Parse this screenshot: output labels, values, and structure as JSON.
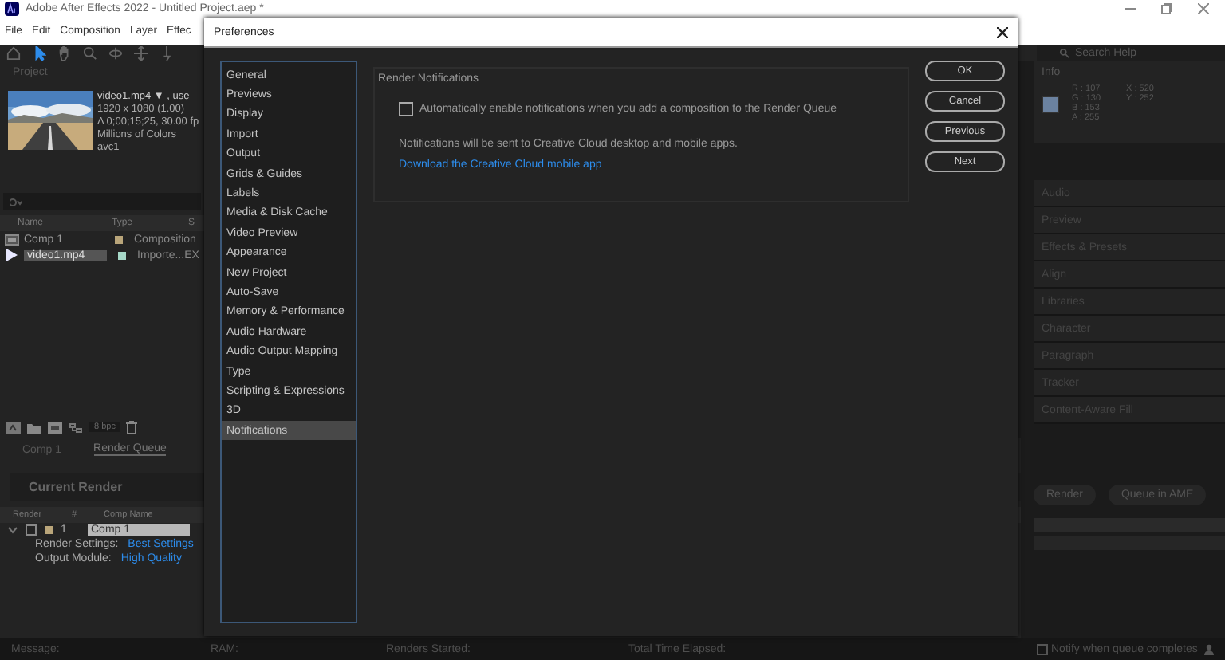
{
  "app_window": {
    "title": "Adobe After Effects 2022 - Untitled Project.aep *"
  },
  "menu_bar": [
    "File",
    "Edit",
    "Composition",
    "Layer",
    "Effec"
  ],
  "project_panel": {
    "title": "Project",
    "footage_info": [
      "video1.mp4 ▼ , use",
      "1920 x 1080 (1.00)",
      "Δ 0;00;15;25, 30.00 fp",
      "Millions of Colors",
      "avc1"
    ],
    "columns": [
      "Name",
      "Type",
      "S"
    ],
    "items": [
      {
        "name": "Comp 1",
        "type": "Composition",
        "kind": "composition",
        "color": "#b9a57a",
        "selected": false
      },
      {
        "name": "video1.mp4",
        "type": "Importe...EX",
        "kind": "footage",
        "color": "#a6d8c8",
        "selected": true
      }
    ],
    "bit_depth": "8 bpc"
  },
  "timeline_tabs": [
    {
      "label": "Comp 1",
      "selected": false
    },
    {
      "label": "Render Queue",
      "selected": true
    }
  ],
  "render_queue": {
    "current_render": "Current Render",
    "columns": [
      "Render",
      "#",
      "Comp Name"
    ],
    "items": [
      {
        "number": "1",
        "comp_name": "Comp 1",
        "checked": false,
        "render_settings_label": "Render Settings:",
        "render_settings": "Best Settings",
        "output_module_label": "Output Module:",
        "output_module": "High Quality"
      }
    ],
    "buttons": [
      "Render",
      "Queue in AME"
    ]
  },
  "right_panel": {
    "search": {
      "placeholder": "Search Help"
    },
    "info": {
      "title": "Info",
      "channels": [
        "R : 107",
        "G : 130",
        "B : 153",
        "A : 255"
      ],
      "coords": [
        "X : 520",
        "Y : 252"
      ]
    },
    "panels": [
      "Audio",
      "Preview",
      "Effects & Presets",
      "Align",
      "Libraries",
      "Character",
      "Paragraph",
      "Tracker",
      "Content-Aware Fill"
    ]
  },
  "status_bar": {
    "message": "Message:",
    "ram": "RAM:",
    "renders_started": "Renders Started:",
    "total_time": "Total Time Elapsed:",
    "notify": {
      "label": "Notify when queue completes",
      "checked": false
    }
  },
  "preferences_dialog": {
    "title": "Preferences",
    "categories": [
      {
        "label": "General",
        "selected": false
      },
      {
        "label": "Previews",
        "selected": false
      },
      {
        "label": "Display",
        "selected": false
      },
      {
        "label": "Import",
        "selected": false
      },
      {
        "label": "Output",
        "selected": false
      },
      {
        "label": "Grids & Guides",
        "selected": false
      },
      {
        "label": "Labels",
        "selected": false
      },
      {
        "label": "Media & Disk Cache",
        "selected": false
      },
      {
        "label": "Video Preview",
        "selected": false
      },
      {
        "label": "Appearance",
        "selected": false
      },
      {
        "label": "New Project",
        "selected": false
      },
      {
        "label": "Auto-Save",
        "selected": false
      },
      {
        "label": "Memory & Performance",
        "selected": false
      },
      {
        "label": "Audio Hardware",
        "selected": false
      },
      {
        "label": "Audio Output Mapping",
        "selected": false
      },
      {
        "label": "Type",
        "selected": false
      },
      {
        "label": "Scripting & Expressions",
        "selected": false
      },
      {
        "label": "3D",
        "selected": false
      },
      {
        "label": "Notifications",
        "selected": true
      }
    ],
    "section": {
      "title": "Render Notifications",
      "auto_enable": {
        "label": "Automatically enable notifications when you add a composition to the Render Queue",
        "checked": false
      },
      "note": "Notifications will be sent to Creative Cloud desktop and mobile apps.",
      "link": "Download the Creative Cloud mobile app"
    },
    "buttons": [
      "OK",
      "Cancel",
      "Previous",
      "Next"
    ]
  }
}
